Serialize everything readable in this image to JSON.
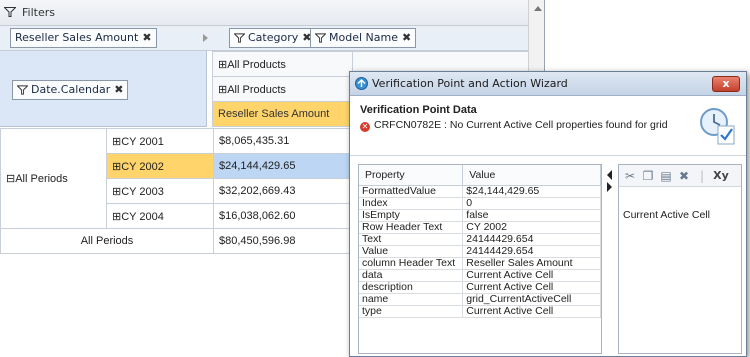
{
  "filters": {
    "label": "Filters"
  },
  "row_fields": [
    {
      "label": "Reseller Sales Amount"
    }
  ],
  "column_fields": [
    {
      "label": "Category"
    },
    {
      "label": "Model Name"
    }
  ],
  "row_dimension": {
    "label": "Date.Calendar"
  },
  "grid": {
    "column_headers": [
      "All Products",
      "All Products"
    ],
    "measure_header": "Reseller Sales Amount",
    "row_group_label": "All Periods",
    "rows": [
      {
        "label": "CY 2001",
        "value": "$8,065,435.31"
      },
      {
        "label": "CY 2002",
        "value": "$24,144,429.65"
      },
      {
        "label": "CY 2003",
        "value": "$32,202,669.43"
      },
      {
        "label": "CY 2004",
        "value": "$16,038,062.60"
      }
    ],
    "total_label": "All Periods",
    "total_value": "$80,450,596.98"
  },
  "wizard": {
    "title": "Verification Point and Action Wizard",
    "close_label": "x",
    "section_title": "Verification Point Data",
    "error_message": "CRFCN0782E : No Current Active Cell properties found for grid",
    "table_headers": {
      "property": "Property",
      "value": "Value"
    },
    "properties": [
      {
        "key": "FormattedValue",
        "value": "$24,144,429.65"
      },
      {
        "key": "Index",
        "value": "0"
      },
      {
        "key": "IsEmpty",
        "value": "false"
      },
      {
        "key": "Row Header Text",
        "value": "CY 2002"
      },
      {
        "key": "Text",
        "value": "24144429.654"
      },
      {
        "key": "Value",
        "value": "24144429.654"
      },
      {
        "key": "column Header Text",
        "value": "Reseller Sales Amount"
      },
      {
        "key": "data",
        "value": "Current Active Cell"
      },
      {
        "key": "description",
        "value": "Current Active Cell"
      },
      {
        "key": "name",
        "value": "grid_CurrentActiveCell"
      },
      {
        "key": "type",
        "value": "Current Active Cell"
      }
    ],
    "toolbar_icons": [
      "cut-icon",
      "copy-icon",
      "paste-icon",
      "delete-icon",
      "xy-icon"
    ],
    "xy_label": "Xy",
    "action_item": "Current Active Cell"
  },
  "colors": {
    "selected_row": "#ffd46b",
    "selected_value": "#bcd6f4",
    "error": "#d43b2a"
  }
}
